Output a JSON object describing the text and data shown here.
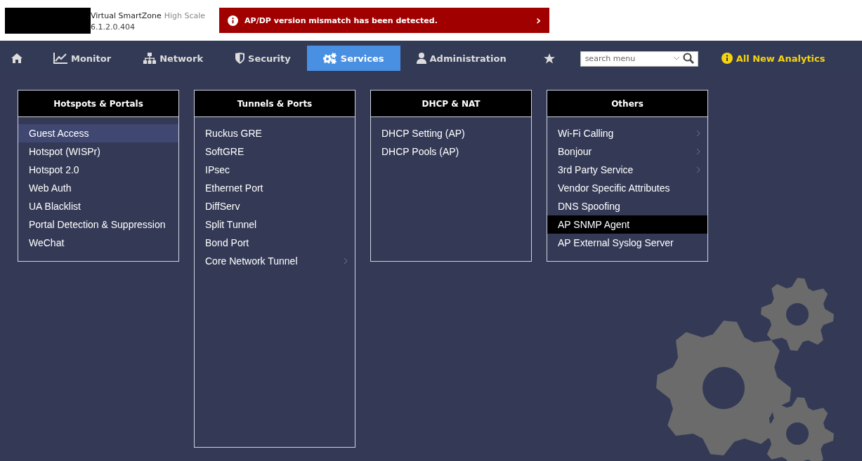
{
  "header": {
    "product": "Virtual SmartZone",
    "edition": "High Scale",
    "version": "6.1.2.0.404"
  },
  "alert": {
    "message": "AP/DP version mismatch has been detected.",
    "arrow": "›"
  },
  "nav": [
    {
      "kind": "home",
      "selected": false
    },
    {
      "kind": "monitor",
      "label": "Monitor",
      "selected": false
    },
    {
      "kind": "network",
      "label": "Network",
      "selected": false
    },
    {
      "kind": "security",
      "label": "Security",
      "selected": false
    },
    {
      "kind": "services",
      "label": "Services",
      "selected": true
    },
    {
      "kind": "admin",
      "label": "Administration",
      "selected": false
    },
    {
      "kind": "star",
      "selected": false
    }
  ],
  "search": {
    "placeholder": "search menu"
  },
  "analytics_link": "All New Analytics",
  "panels": [
    {
      "title": "Hotspots & Portals",
      "expanded": false,
      "items": [
        {
          "label": "Guest Access",
          "highlighted": true,
          "selected": false,
          "has_submenu": false
        },
        {
          "label": "Hotspot (WISPr)",
          "highlighted": false,
          "selected": false,
          "has_submenu": false
        },
        {
          "label": "Hotspot 2.0",
          "highlighted": false,
          "selected": false,
          "has_submenu": false
        },
        {
          "label": "Web Auth",
          "highlighted": false,
          "selected": false,
          "has_submenu": false
        },
        {
          "label": "UA Blacklist",
          "highlighted": false,
          "selected": false,
          "has_submenu": false
        },
        {
          "label": "Portal Detection & Suppression",
          "highlighted": false,
          "selected": false,
          "has_submenu": false
        },
        {
          "label": "WeChat",
          "highlighted": false,
          "selected": false,
          "has_submenu": false
        }
      ]
    },
    {
      "title": "Tunnels & Ports",
      "expanded": true,
      "items": [
        {
          "label": "Ruckus GRE",
          "highlighted": false,
          "selected": false,
          "has_submenu": false
        },
        {
          "label": "SoftGRE",
          "highlighted": false,
          "selected": false,
          "has_submenu": false
        },
        {
          "label": "IPsec",
          "highlighted": false,
          "selected": false,
          "has_submenu": false
        },
        {
          "label": "Ethernet Port",
          "highlighted": false,
          "selected": false,
          "has_submenu": false
        },
        {
          "label": "DiffServ",
          "highlighted": false,
          "selected": false,
          "has_submenu": false
        },
        {
          "label": "Split Tunnel",
          "highlighted": false,
          "selected": false,
          "has_submenu": false
        },
        {
          "label": "Bond Port",
          "highlighted": false,
          "selected": false,
          "has_submenu": false
        },
        {
          "label": "Core Network Tunnel",
          "highlighted": false,
          "selected": false,
          "has_submenu": true
        }
      ]
    },
    {
      "title": "DHCP & NAT",
      "expanded": false,
      "items": [
        {
          "label": "DHCP Setting (AP)",
          "highlighted": false,
          "selected": false,
          "has_submenu": false
        },
        {
          "label": "DHCP Pools (AP)",
          "highlighted": false,
          "selected": false,
          "has_submenu": false
        }
      ]
    },
    {
      "title": "Others",
      "expanded": false,
      "items": [
        {
          "label": "Wi-Fi Calling",
          "highlighted": false,
          "selected": false,
          "has_submenu": true
        },
        {
          "label": "Bonjour",
          "highlighted": false,
          "selected": false,
          "has_submenu": true
        },
        {
          "label": "3rd Party Service",
          "highlighted": false,
          "selected": false,
          "has_submenu": true
        },
        {
          "label": "Vendor Specific Attributes",
          "highlighted": false,
          "selected": false,
          "has_submenu": false
        },
        {
          "label": "DNS Spoofing",
          "highlighted": false,
          "selected": false,
          "has_submenu": false
        },
        {
          "label": "AP SNMP Agent",
          "highlighted": false,
          "selected": true,
          "has_submenu": false
        },
        {
          "label": "AP External Syslog Server",
          "highlighted": false,
          "selected": false,
          "has_submenu": false
        }
      ]
    }
  ]
}
